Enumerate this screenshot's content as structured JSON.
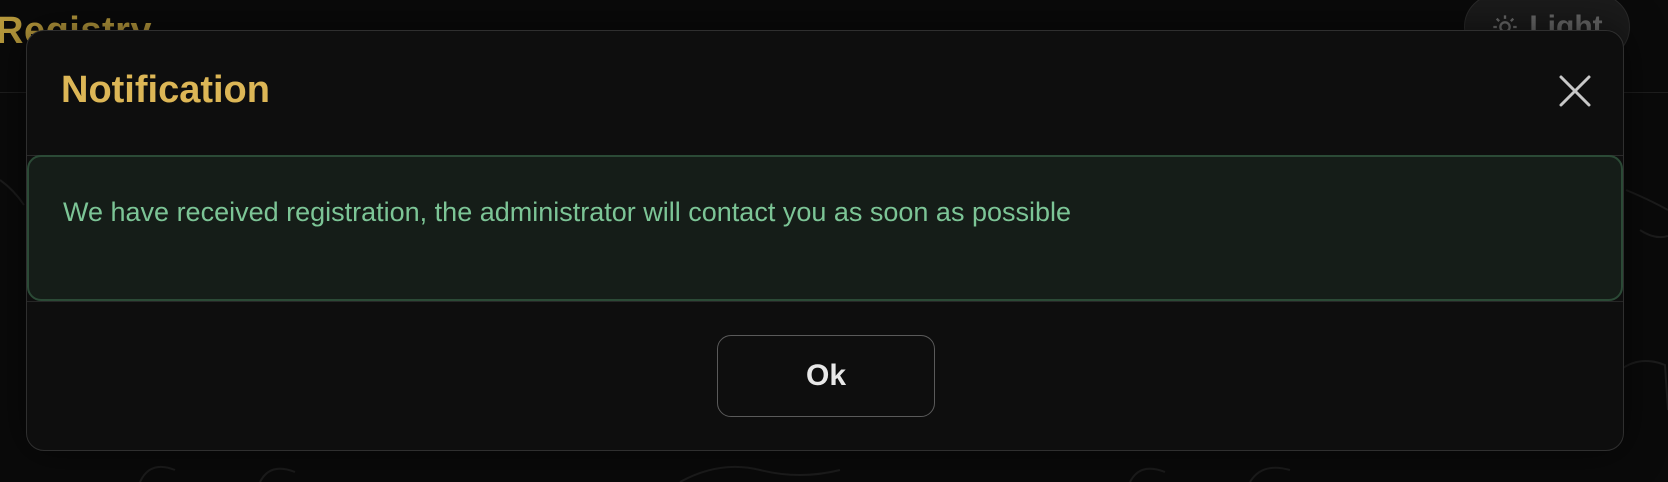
{
  "background": {
    "page_title": "Registry",
    "theme_toggle": {
      "label": "Light",
      "icon": "gear-icon"
    }
  },
  "modal": {
    "title": "Notification",
    "close_icon": "close-icon",
    "message": "We have received registration, the administrator will contact you as soon as possible",
    "ok_label": "Ok"
  },
  "colors": {
    "title": "#dcb656",
    "alert_text": "#7cc596",
    "alert_bg": "#151d18",
    "alert_border": "#2b4a36",
    "modal_bg": "#0e0e0e"
  }
}
